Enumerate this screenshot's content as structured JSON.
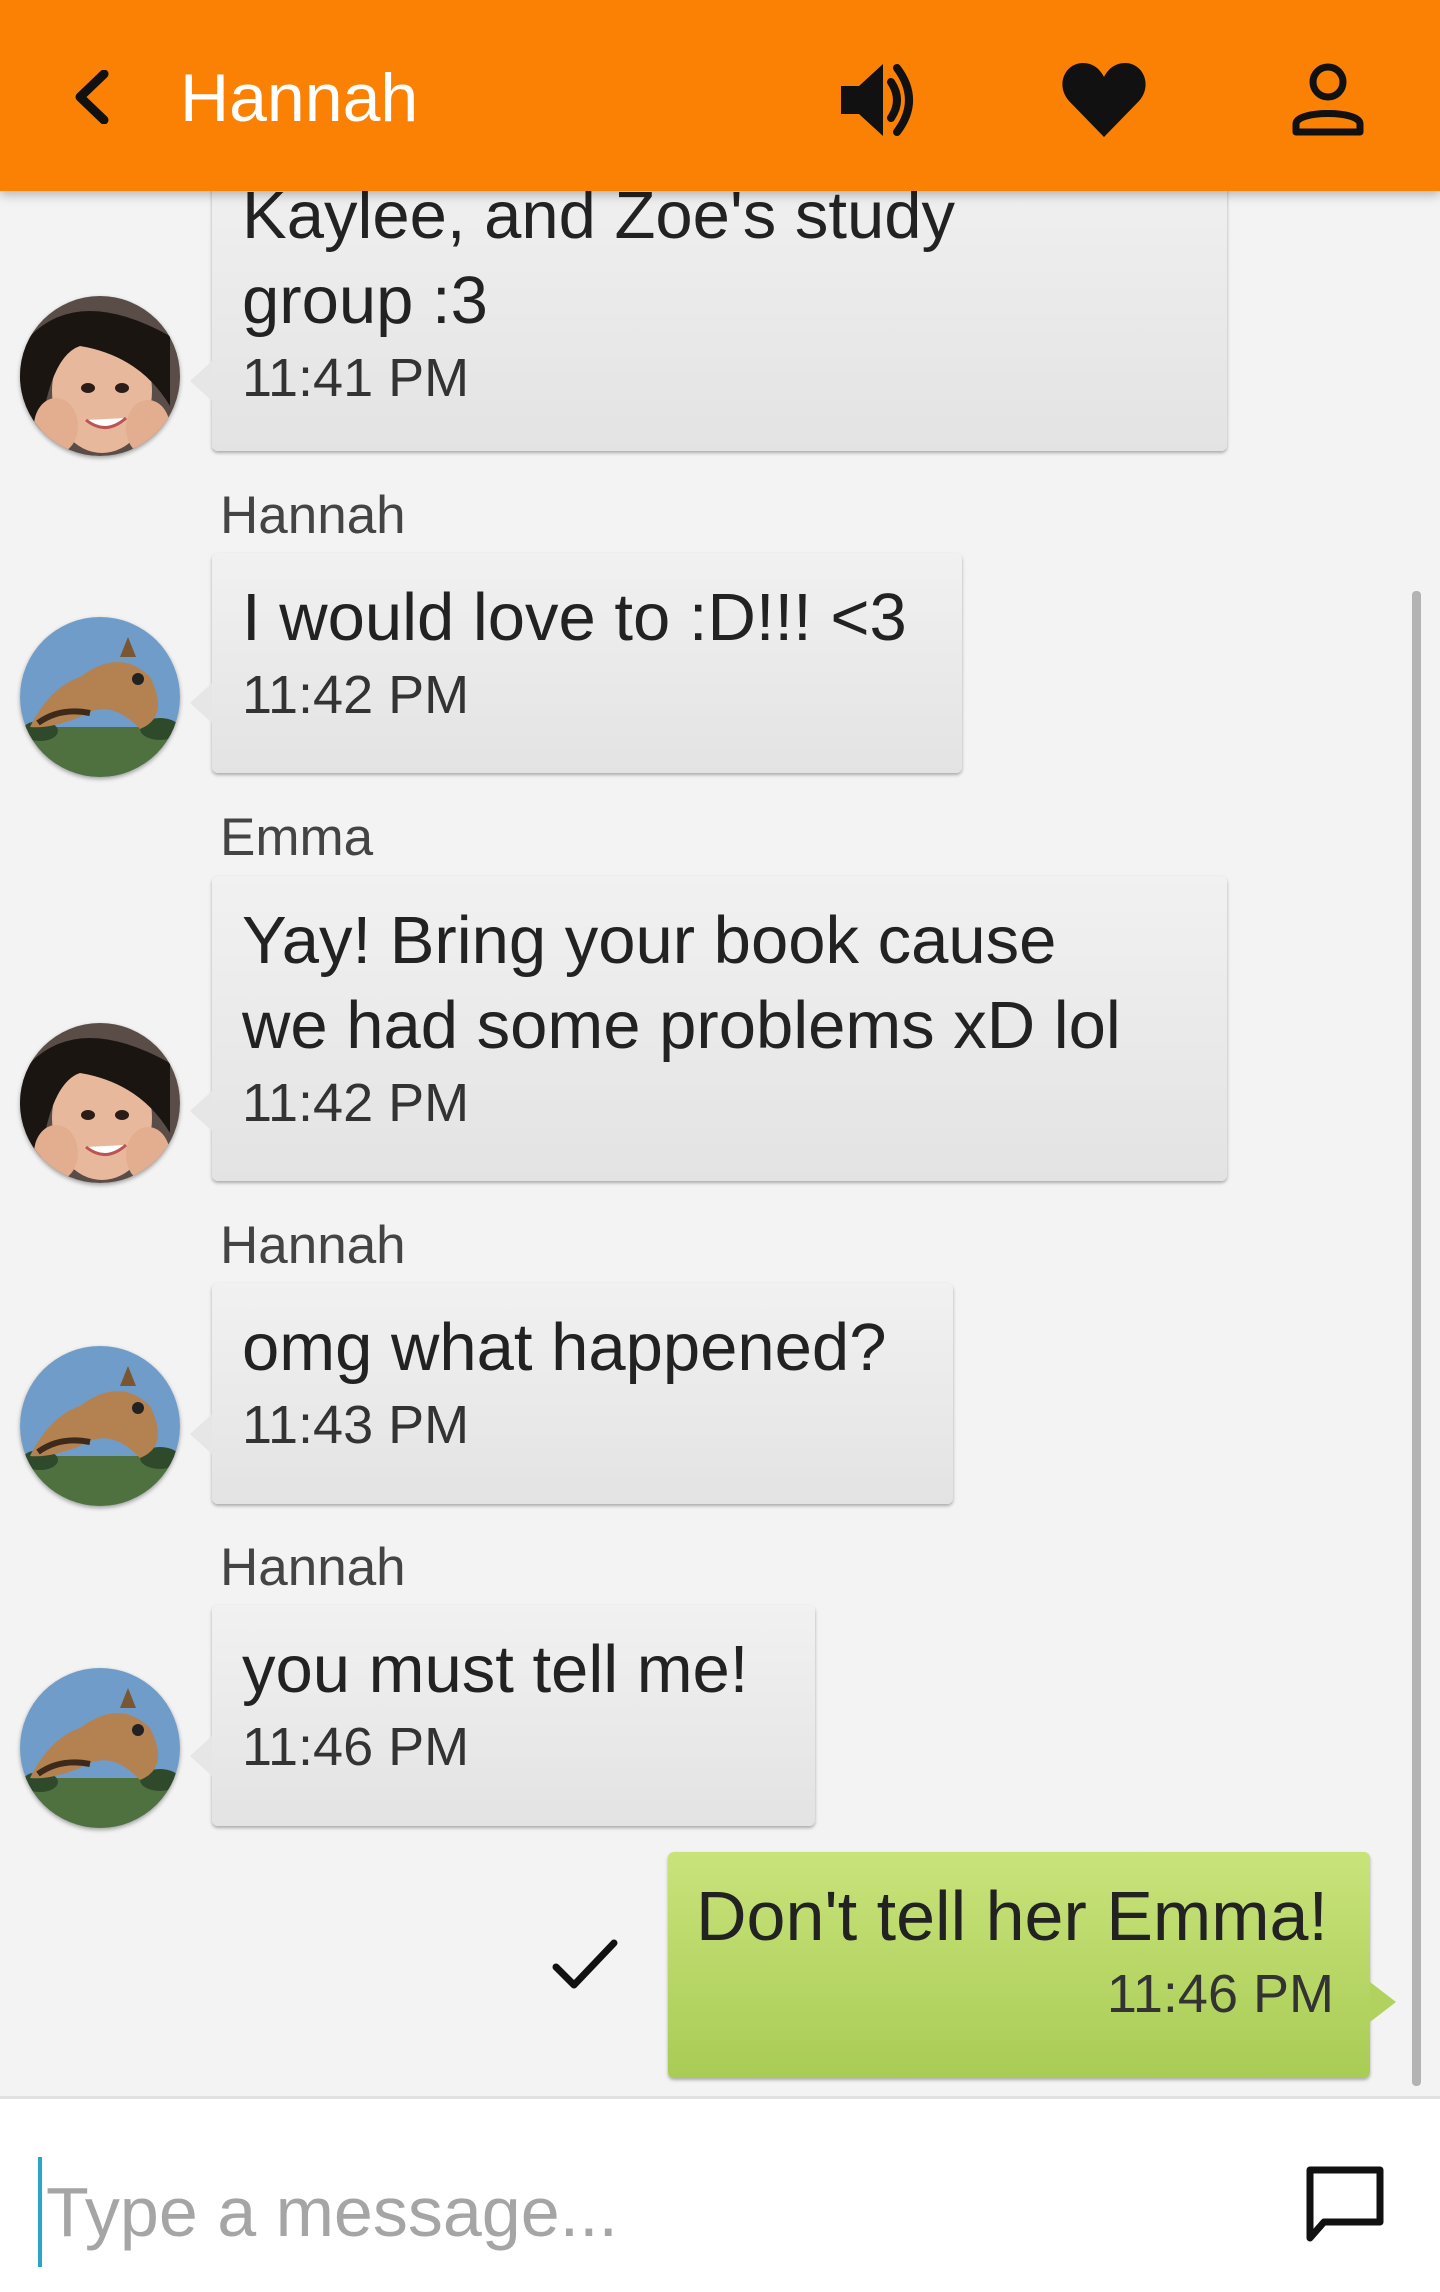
{
  "header": {
    "title": "Hannah",
    "back_icon": "chevron-left-icon",
    "actions": [
      {
        "icon": "volume-icon"
      },
      {
        "icon": "heart-icon"
      },
      {
        "icon": "person-icon"
      }
    ],
    "bg_color": "#fb8105"
  },
  "messages": [
    {
      "sender": "",
      "avatar": "emma-avatar",
      "lines": [
        "Kaylee, and Zoe's study",
        "group :3"
      ],
      "time": "11:41 PM"
    },
    {
      "sender": "Hannah",
      "avatar": "hannah-avatar",
      "lines": [
        "I would love to :D!!! <3"
      ],
      "time": "11:42 PM"
    },
    {
      "sender": "Emma",
      "avatar": "emma-avatar",
      "lines": [
        "Yay! Bring your book cause",
        "we had some problems xD lol"
      ],
      "time": "11:42 PM"
    },
    {
      "sender": "Hannah",
      "avatar": "hannah-avatar",
      "lines": [
        "omg what happened?"
      ],
      "time": "11:43 PM"
    },
    {
      "sender": "Hannah",
      "avatar": "hannah-avatar",
      "lines": [
        "you must tell me!"
      ],
      "time": "11:46 PM"
    }
  ],
  "outgoing": {
    "text": "Don't tell her Emma!",
    "time": "11:46 PM",
    "status_icon": "checkmark-icon",
    "bubble_color": "#bcdc6c"
  },
  "composer": {
    "placeholder": "Type a message...",
    "value": "",
    "send_icon": "chat-bubble-icon"
  }
}
